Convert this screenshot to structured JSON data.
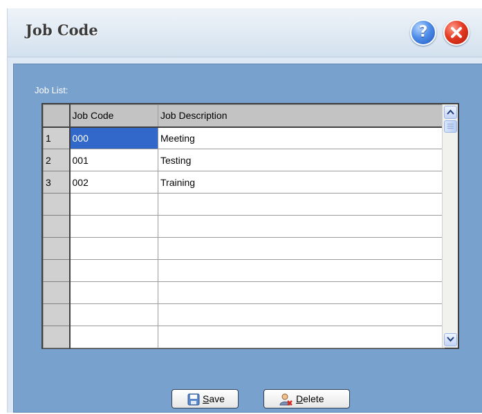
{
  "window": {
    "title": "Job Code"
  },
  "panel": {
    "list_label": "Job List:"
  },
  "grid": {
    "columns": [
      "Job Code",
      "Job Description"
    ],
    "rows": [
      {
        "num": "1",
        "code": "000",
        "description": "Meeting"
      },
      {
        "num": "2",
        "code": "001",
        "description": "Testing"
      },
      {
        "num": "3",
        "code": "002",
        "description": "Training"
      }
    ],
    "selected_cell": "row 1, Job Code"
  },
  "buttons": {
    "save": {
      "first_letter": "S",
      "rest": "ave"
    },
    "delete": {
      "first_letter": "D",
      "rest": "elete"
    }
  },
  "icons": {
    "help": "help-icon",
    "close": "close-icon",
    "save": "save-icon",
    "delete": "delete-user-icon"
  },
  "colors": {
    "panel": "#79a1cd",
    "selection": "#3168c9",
    "close": "#e43a22",
    "help": "#4f8ee8"
  }
}
